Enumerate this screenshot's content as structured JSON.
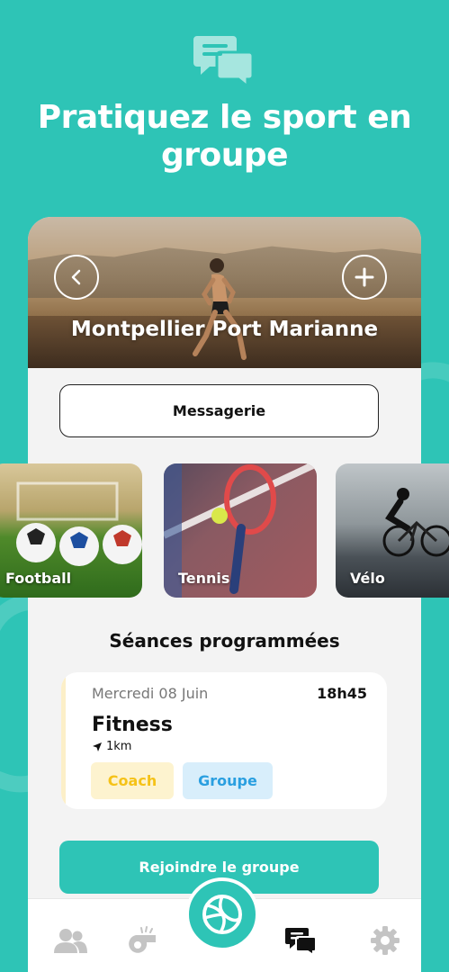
{
  "hero": {
    "headline": "Pratiquez le sport en groupe",
    "icon": "chat-bubbles-icon"
  },
  "group": {
    "name": "Montpellier Port Marianne",
    "back_icon": "chevron-left-icon",
    "add_icon": "plus-icon"
  },
  "messagerie": {
    "label": "Messagerie"
  },
  "sports": [
    {
      "label": "Football"
    },
    {
      "label": "Tennis"
    },
    {
      "label": "Vélo"
    }
  ],
  "sessions": {
    "title": "Séances programmées",
    "items": [
      {
        "date": "Mercredi 08 Juin",
        "time": "18h45",
        "name": "Fitness",
        "distance": "1km",
        "tags": [
          "Coach",
          "Groupe"
        ]
      }
    ]
  },
  "join": {
    "label": "Rejoindre le groupe"
  },
  "tabbar": {
    "icons": [
      "users-icon",
      "whistle-icon",
      "volleyball-icon",
      "chat-icon",
      "gear-icon"
    ],
    "active": "chat-icon"
  },
  "colors": {
    "accent": "#2ec4b6",
    "coach_tag_text": "#f5c218",
    "coach_tag_bg": "#fdf3cf",
    "groupe_tag_text": "#2a9fe0",
    "groupe_tag_bg": "#d8eefb"
  }
}
